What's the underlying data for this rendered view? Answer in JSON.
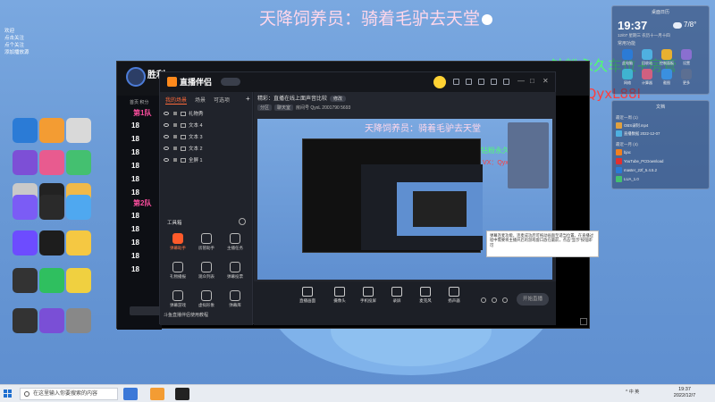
{
  "overlay": {
    "title": "天降饲养员：骑着毛驴去天堂",
    "fans": "钻粉永久车位+房管",
    "vx": "VX：QyxL88I"
  },
  "desktop_icons": [
    {
      "label": "",
      "color": "#2b7bd6"
    },
    {
      "label": "",
      "color": "#f39c33"
    },
    {
      "label": "",
      "color": "#d9d9d9"
    },
    {
      "label": "",
      "color": "#7d4fd6"
    },
    {
      "label": "",
      "color": "#e85b8f"
    },
    {
      "label": "",
      "color": "#44c070"
    },
    {
      "label": "",
      "color": "#c9c9c9"
    },
    {
      "label": "",
      "color": "#222"
    },
    {
      "label": "",
      "color": "#f0b94a"
    },
    {
      "label": "",
      "color": "#7b5cf5"
    },
    {
      "label": "",
      "color": "#2a2a2a"
    },
    {
      "label": "",
      "color": "#4fa8f0"
    },
    {
      "label": "",
      "color": "#6d4cff"
    },
    {
      "label": "",
      "color": "#1d1d1d"
    },
    {
      "label": "",
      "color": "#f5c842"
    },
    {
      "label": "",
      "color": "#333"
    },
    {
      "label": "",
      "color": "#2fbf5f"
    },
    {
      "label": "",
      "color": "#f0d040"
    },
    {
      "label": "",
      "color": "#333"
    },
    {
      "label": "",
      "color": "#7a4fd6"
    },
    {
      "label": "",
      "color": "#888"
    }
  ],
  "notes": {
    "lines": [
      "欢迎",
      "点击关注",
      "点个关注",
      "添加播放源"
    ]
  },
  "main_window": {
    "title": "胜利",
    "subtitle": "",
    "top_tabs": "首页  积分",
    "team1": "第1队",
    "team2": "第2队",
    "rows": [
      "18",
      "18",
      "18",
      "18",
      "18",
      "18",
      "18",
      "18",
      "18",
      "18",
      "18"
    ],
    "bottom_link": "",
    "bottom_more": ""
  },
  "zhibo": {
    "brand": "直播伴侣",
    "version": "",
    "sidebar_tabs": [
      "我的场景",
      "场景",
      "可选项"
    ],
    "layers": [
      "礼物秀",
      "文本 4",
      "文本 3",
      "文本 2",
      "全屏 1"
    ],
    "tools_title": "工具箱",
    "tools": [
      {
        "label": "弹幕助手",
        "hot": true
      },
      {
        "label": "房管助手",
        "hot": false
      },
      {
        "label": "主播任务",
        "hot": false
      },
      {
        "label": "礼物播报",
        "hot": false
      },
      {
        "label": "观众列表",
        "hot": false
      },
      {
        "label": "弹幕投票",
        "hot": false
      },
      {
        "label": "弹幕游戏",
        "hot": false
      },
      {
        "label": "虚拟形象",
        "hot": false
      },
      {
        "label": "弹幕库",
        "hot": false
      }
    ],
    "footer": "斗鱼直播伴侣使用教程",
    "topic_label": "精彩",
    "topic": "直播在线上面声音比较",
    "topic_btn": "修改",
    "info_tags": [
      "分区",
      "聊天室"
    ],
    "info_text": "房间号 QyxL  2001790  5693",
    "preview_title": "天降饲养员：骑着毛驴去天堂",
    "preview_fans": "钻粉永久车位+房管",
    "preview_vx": "VX：QyxL88I",
    "tooltip": "弹幕连麦功能，连麦成功后可拖动画面至适当位置。在直播过程中需要将主播开启的游戏窗口放在最前，点击“显示”按钮即可",
    "controls": [
      "直播画面",
      "摄像头",
      "手机投屏",
      "录屏",
      "麦克风",
      "扬声器"
    ],
    "start_btn": "开始直播"
  },
  "widget": {
    "head": "桌面日历",
    "time": "19:37",
    "date": "12/07 星期三 农历十一月十四",
    "temp": "7/8°",
    "shortcuts_label": "常用功能",
    "apps": [
      {
        "label": "此电脑",
        "color": "#2b7bd6"
      },
      {
        "label": "回收站",
        "color": "#4fb0e0"
      },
      {
        "label": "控制面板",
        "color": "#e8b030"
      },
      {
        "label": "设置",
        "color": "#8a6fd0"
      },
      {
        "label": "网络",
        "color": "#3fb4d0"
      },
      {
        "label": "计算器",
        "color": "#d06080"
      },
      {
        "label": "截图",
        "color": "#3a90e0"
      },
      {
        "label": "更多",
        "color": "#5c6f92"
      }
    ]
  },
  "files": {
    "head": "文档",
    "sec1": "最近一周 (1)",
    "items1": [
      {
        "label": "OBS录制.mp4",
        "color": "#e0a040"
      },
      {
        "label": "直播数据 2022-12-07",
        "color": "#4fb0e0"
      }
    ],
    "sec2": "最近一月 (4)",
    "items2": [
      {
        "label": "bjac",
        "color": "#f08020"
      },
      {
        "label": "YouTube_PCDownload",
        "color": "#e03030"
      },
      {
        "label": "master_22f_5.4.5.2",
        "color": "#2b7bd6"
      },
      {
        "label": "LUA_1.0",
        "color": "#44c070"
      }
    ]
  },
  "taskbar": {
    "search_placeholder": "在这里输入你要搜索的内容",
    "apps": [
      {
        "name": "edge-app",
        "color": "#3b78d8"
      },
      {
        "name": "live-app",
        "color": "#f39c33"
      },
      {
        "name": "game-app",
        "color": "#222"
      }
    ],
    "tray": "^ 中 英",
    "time": "19:37",
    "date": "2022/12/7"
  }
}
